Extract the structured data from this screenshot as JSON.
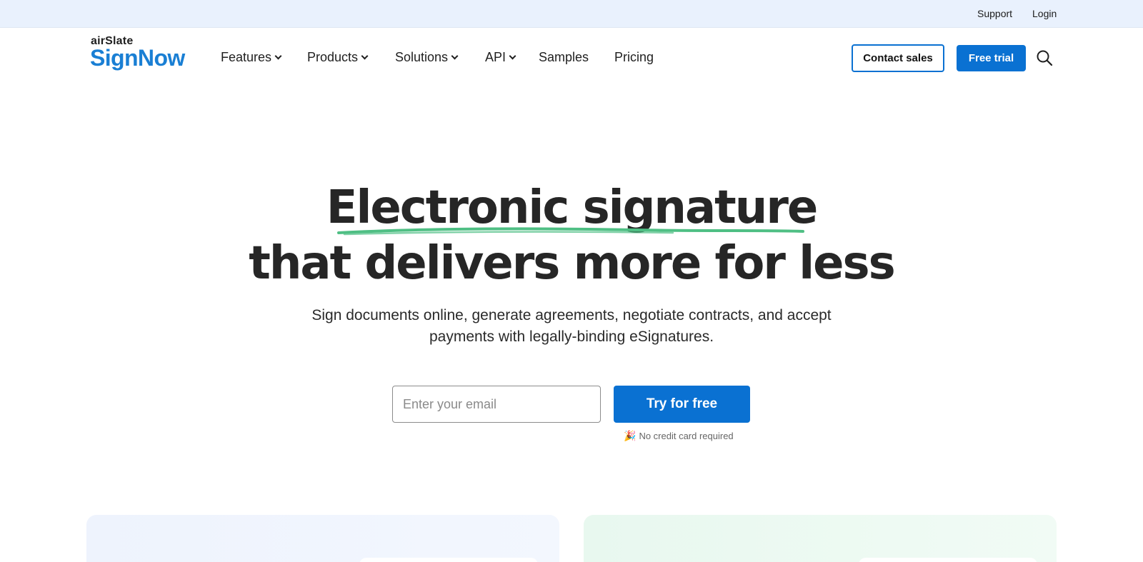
{
  "topbar": {
    "support": "Support",
    "login": "Login"
  },
  "logo": {
    "small": "airSlate",
    "big": "SignNow"
  },
  "nav": {
    "items": [
      {
        "label": "Features",
        "has_dropdown": true
      },
      {
        "label": "Products",
        "has_dropdown": true
      },
      {
        "label": "Solutions",
        "has_dropdown": true
      },
      {
        "label": "API",
        "has_dropdown": true
      },
      {
        "label": "Samples",
        "has_dropdown": false
      },
      {
        "label": "Pricing",
        "has_dropdown": false
      }
    ],
    "contact_sales": "Contact sales",
    "free_trial": "Free trial",
    "search_icon": "search-icon"
  },
  "hero": {
    "title_line1": "Electronic signature",
    "title_line2": "that delivers more for less",
    "subtitle_line1": "Sign documents online, generate agreements, negotiate contracts, and accept",
    "subtitle_line2": "payments with legally-binding eSignatures.",
    "email_placeholder": "Enter your email",
    "cta": "Try for free",
    "note": "No credit card required",
    "note_icon": "party-popper-icon"
  },
  "colors": {
    "accent": "#0a71d2",
    "logo_blue": "#1a7fd4",
    "underline_green": "#4fbf84",
    "topbar_bg": "#e9f1fd"
  }
}
